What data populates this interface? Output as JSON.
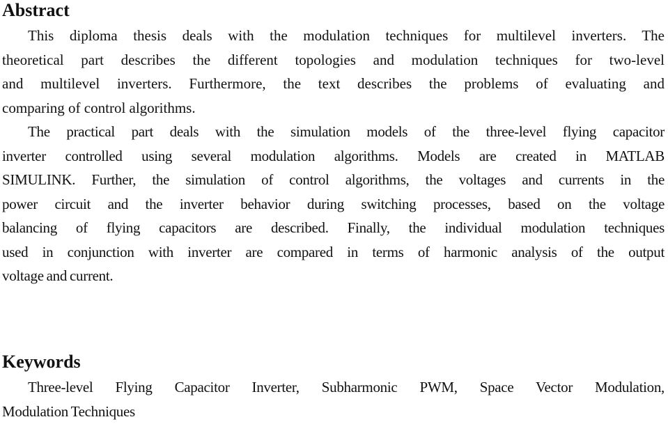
{
  "abstract": {
    "heading": "Abstract",
    "paragraphs": [
      {
        "lines": [
          "This diploma thesis deals with the modulation techniques for multilevel inverters. The",
          "theoretical part describes the different topologies and modulation techniques for two-level",
          "and multilevel inverters. Furthermore, the text describes the problems of evaluating and",
          "comparing of control algorithms."
        ]
      },
      {
        "lines": [
          "The practical part deals with the simulation models of the three-level flying capacitor",
          "inverter controlled using several modulation algorithms. Models are created in MATLAB",
          "SIMULINK. Further, the simulation of control algorithms, the voltages and currents in the",
          "power circuit and the inverter behavior during switching processes, based on the voltage",
          "balancing of flying capacitors are described. Finally, the individual modulation techniques",
          "used in conjunction with inverter are compared in terms of harmonic analysis of the output",
          "voltage and current."
        ]
      }
    ]
  },
  "keywords": {
    "heading": "Keywords",
    "lines": [
      "Three-level Flying Capacitor Inverter, Subharmonic PWM, Space Vector Modulation,",
      "Modulation Techniques"
    ]
  }
}
